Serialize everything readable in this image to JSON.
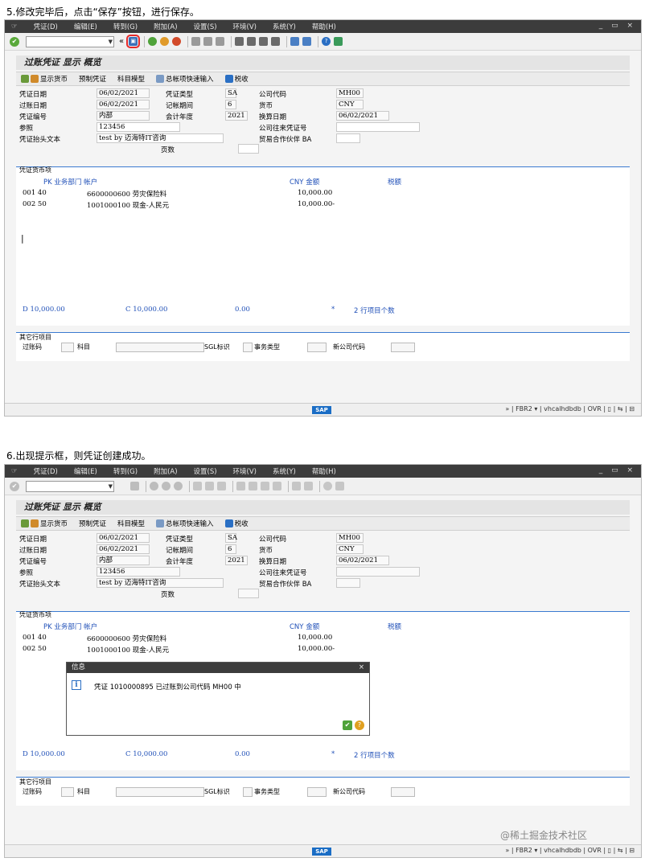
{
  "captions": {
    "step5": "5.修改完毕后，点击“保存”按钮，进行保存。",
    "step6": "6.出现提示框，则凭证创建成功。"
  },
  "menu": [
    "凭证(D)",
    "编辑(E)",
    "转到(G)",
    "附加(A)",
    "设置(S)",
    "环境(V)",
    "系统(Y)",
    "帮助(H)"
  ],
  "window_controls": "_ ▭ ×",
  "toolbar": {
    "history": "«"
  },
  "screen_title": "过账凭证 显示 概览",
  "app_toolbar": [
    "显示货币",
    "预制凭证",
    "科目模型",
    "总帐项快速输入",
    "税收"
  ],
  "header": {
    "doc_date_label": "凭证日期",
    "doc_date": "06/02/2021",
    "post_date_label": "过账日期",
    "post_date": "06/02/2021",
    "doc_no_label": "凭证编号",
    "doc_no": "内部",
    "ref_label": "参照",
    "ref": "123456",
    "header_text_label": "凭证抬头文本",
    "header_text": "test by 迈海特IT咨询",
    "doc_type_label": "凭证类型",
    "doc_type": "SA",
    "period_label": "记帐期间",
    "period": "6",
    "fiscal_year_label": "会计年度",
    "fiscal_year": "2021",
    "page_label": "页数",
    "company_label": "公司代码",
    "company": "MH00",
    "currency_label": "货币",
    "currency": "CNY",
    "trans_date_label": "换算日期",
    "trans_date": "06/02/2021",
    "ic_label": "公司往来凭证号",
    "partner_label": "贸易合作伙伴 BA"
  },
  "items": {
    "section_title": "凭证货币项",
    "col_header": "PK 业务部门 帐户",
    "cur_header": "CNY  金额",
    "tax_header": "税额",
    "rows": [
      {
        "no": "001 40",
        "account": "6600000600 劳灾保险料",
        "amount": "10,000.00"
      },
      {
        "no": "002 50",
        "account": "1001000100 现金-人民元",
        "amount": "10,000.00-"
      }
    ],
    "totals": {
      "debit": "D 10,000.00",
      "credit": "C 10,000.00",
      "balance": "0.00",
      "star": "*",
      "count": "2 行项目个数"
    }
  },
  "other_items": {
    "title": "其它行项目",
    "gl_label": "过账码",
    "acct_label": "科目",
    "sgl_label": "SGL标识",
    "trans_label": "事务类型",
    "newco_label": "新公司代码"
  },
  "status": {
    "sap": "SAP",
    "right": "» | FBR2 ▾ | vhcalhdbdb | OVR | ▯ | ⇆ | ⊟"
  },
  "dialog": {
    "title": "信息",
    "close": "×",
    "message": "凭证 1010000895 已过账到公司代码 MH00 中"
  },
  "watermark": "@稀土掘金技术社区"
}
